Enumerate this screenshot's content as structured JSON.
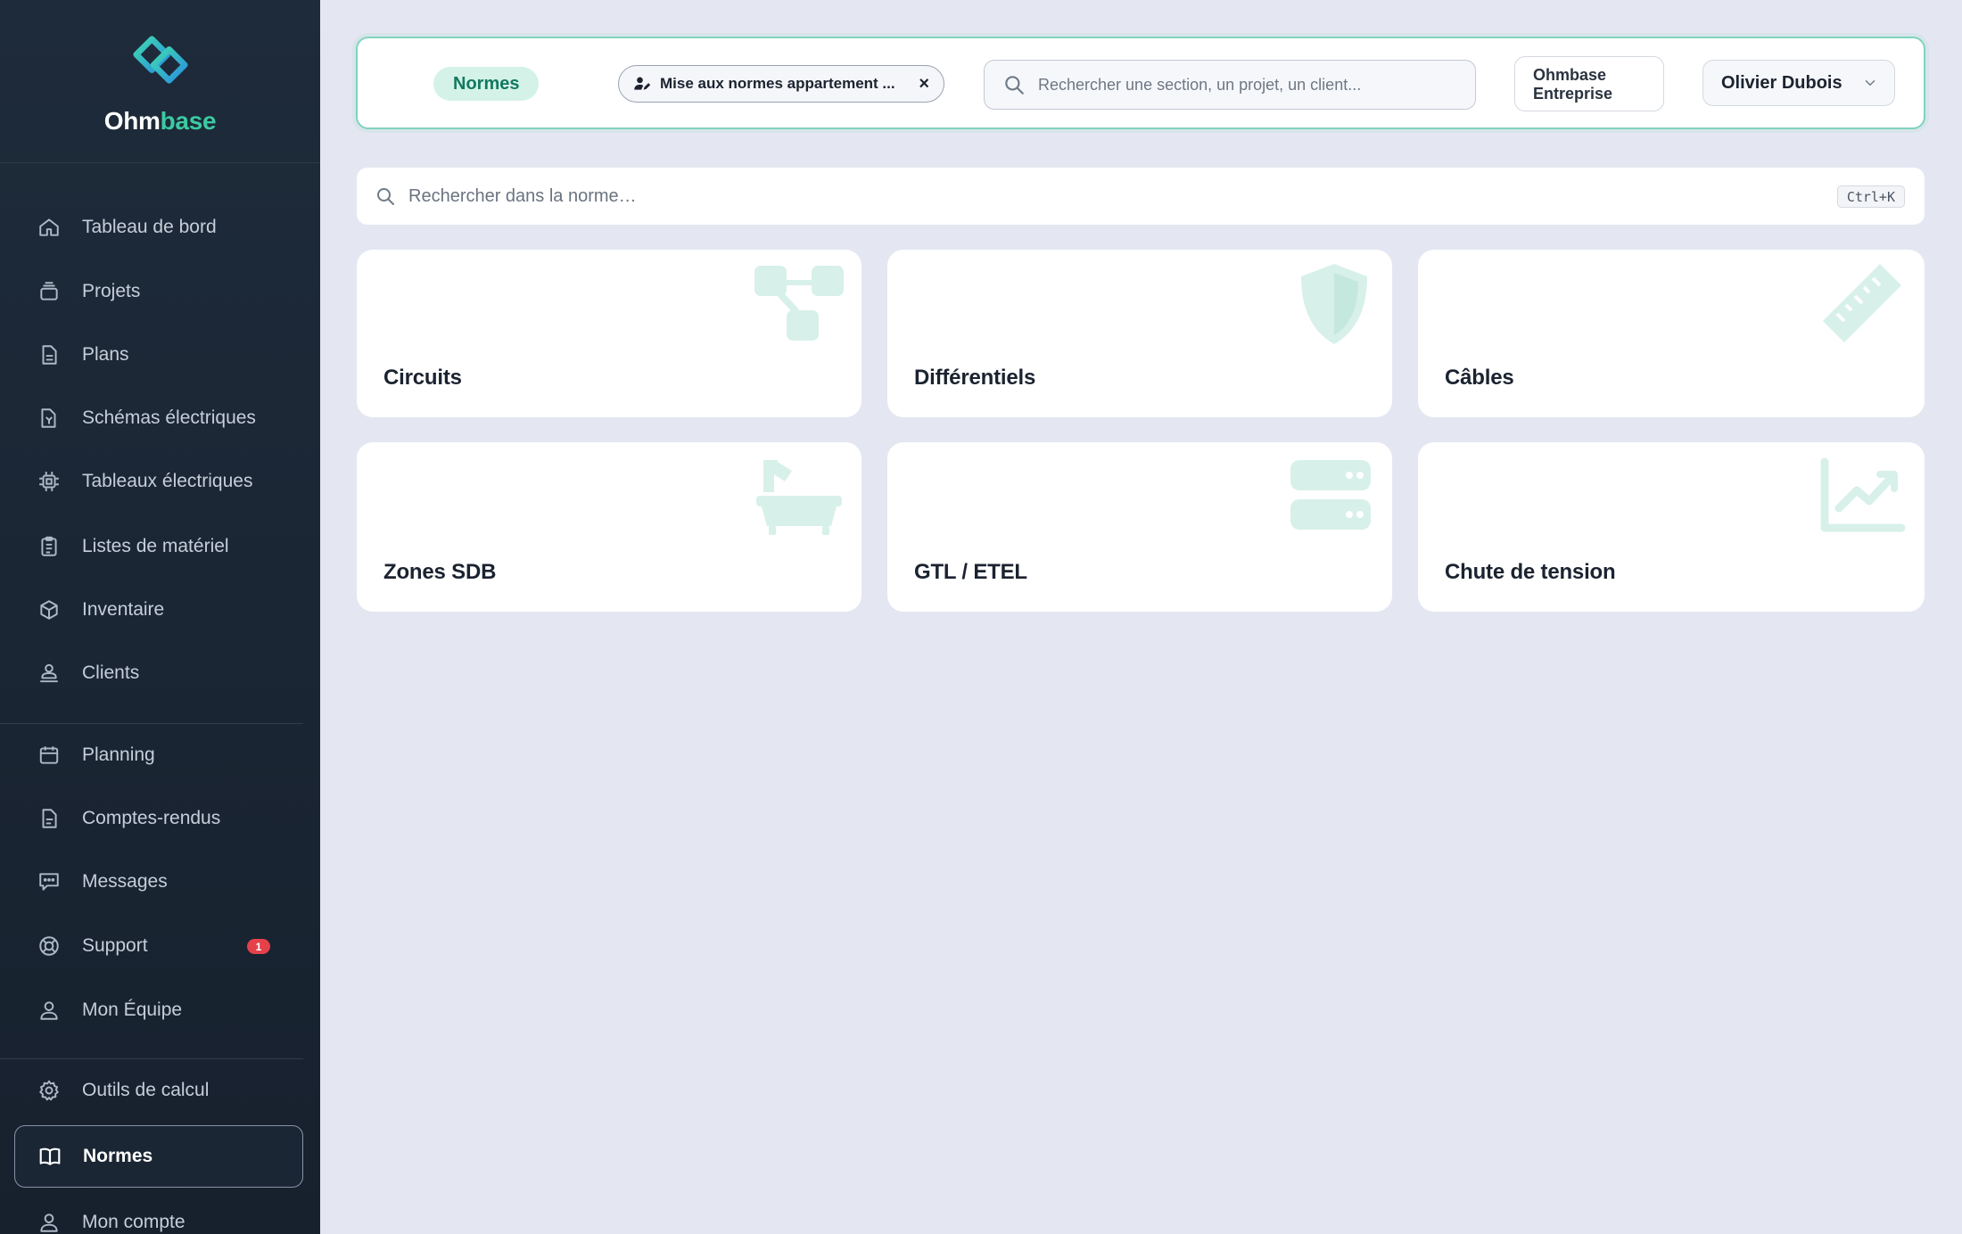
{
  "sidebar": {
    "brand": {
      "name_main": "Ohm",
      "name_accent": "base"
    },
    "items": [
      {
        "id": "dashboard",
        "label": "Tableau de bord",
        "icon": "home-icon"
      },
      {
        "id": "projects",
        "label": "Projets",
        "icon": "folder-stack-icon"
      },
      {
        "id": "plans",
        "label": "Plans",
        "icon": "document-icon"
      },
      {
        "id": "schemas",
        "label": "Schémas électriques",
        "icon": "schema-icon"
      },
      {
        "id": "panels",
        "label": "Tableaux électriques",
        "icon": "chip-icon"
      },
      {
        "id": "materials",
        "label": "Listes de matériel",
        "icon": "clipboard-icon"
      },
      {
        "id": "inventory",
        "label": "Inventaire",
        "icon": "cube-icon"
      },
      {
        "id": "clients",
        "label": "Clients",
        "icon": "client-icon"
      },
      {
        "id": "planning",
        "label": "Planning",
        "icon": "calendar-icon"
      },
      {
        "id": "reports",
        "label": "Comptes-rendus",
        "icon": "report-icon"
      },
      {
        "id": "messages",
        "label": "Messages",
        "icon": "chat-icon"
      },
      {
        "id": "support",
        "label": "Support",
        "icon": "lifebuoy-icon",
        "badge": "1"
      },
      {
        "id": "team",
        "label": "Mon Équipe",
        "icon": "team-icon"
      },
      {
        "id": "tools",
        "label": "Outils de calcul",
        "icon": "gear-icon"
      },
      {
        "id": "normes",
        "label": "Normes",
        "icon": "book-icon",
        "active": true
      },
      {
        "id": "account",
        "label": "Mon compte",
        "icon": "user-icon"
      }
    ]
  },
  "topbar": {
    "section_pill": "Normes",
    "project_chip": "Mise aux normes appartement ...",
    "project_chip_close": "×",
    "search_placeholder": "Rechercher une section, un projet, un client...",
    "org_line1": "Ohmbase",
    "org_line2": "Entreprise",
    "user_name": "Olivier Dubois"
  },
  "norm_search": {
    "placeholder": "Rechercher dans la norme…",
    "shortcut": "Ctrl+K"
  },
  "cards": [
    {
      "title": "Circuits",
      "icon": "circuit-tree-icon"
    },
    {
      "title": "Différentiels",
      "icon": "shield-icon"
    },
    {
      "title": "Câbles",
      "icon": "ruler-icon"
    },
    {
      "title": "Zones SDB",
      "icon": "bathtub-icon"
    },
    {
      "title": "GTL / ETEL",
      "icon": "server-icon"
    },
    {
      "title": "Chute de tension",
      "icon": "chart-line-icon"
    }
  ],
  "colors": {
    "sidebar_bg": "#1e2b3a",
    "accent": "#3ccaa2",
    "page_bg": "#e4e7f1",
    "badge": "#e5414b"
  }
}
